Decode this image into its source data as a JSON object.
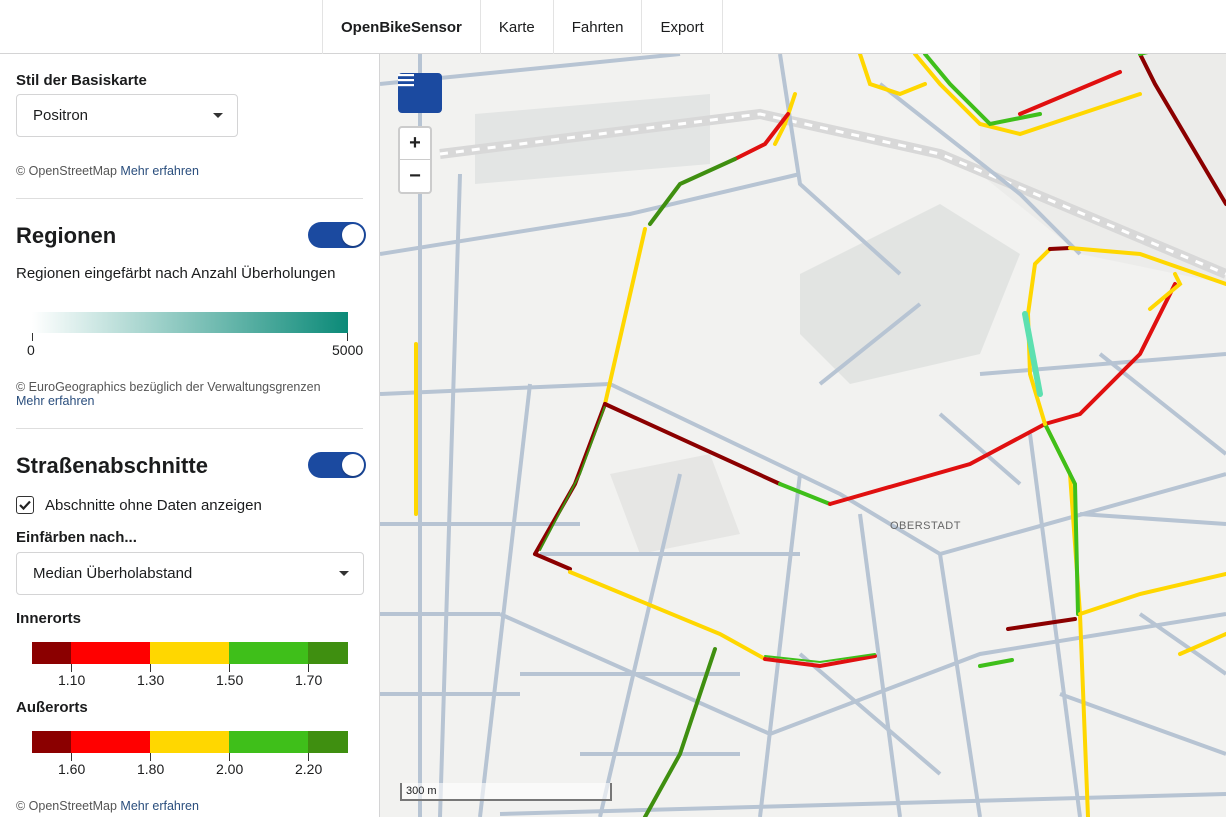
{
  "nav": {
    "brand": "OpenBikeSensor",
    "items": [
      "Karte",
      "Fahrten",
      "Export"
    ]
  },
  "sidebar": {
    "basemap": {
      "label": "Stil der Basiskarte",
      "selected": "Positron",
      "attribution": "© OpenStreetMap",
      "link": "Mehr erfahren"
    },
    "regions": {
      "title": "Regionen",
      "enabled": true,
      "description": "Regionen eingefärbt nach Anzahl Überholungen",
      "gradient_min": "0",
      "gradient_max": "5000",
      "gradient_colors": [
        "#ffffff",
        "#0b8a78"
      ],
      "attribution": "© EuroGeographics bezüglich der Verwaltungsgrenzen",
      "link": "Mehr erfahren"
    },
    "segments": {
      "title": "Straßenabschnitte",
      "enabled": true,
      "checkbox_label": "Abschnitte ohne Daten anzeigen",
      "checkbox_checked": true,
      "color_by_label": "Einfärben nach...",
      "color_by_selected": "Median Überholabstand",
      "innerorts": {
        "title": "Innerorts",
        "ticks": [
          "1.10",
          "1.30",
          "1.50",
          "1.70"
        ]
      },
      "ausserorts": {
        "title": "Außerorts",
        "ticks": [
          "1.60",
          "1.80",
          "2.00",
          "2.20"
        ]
      },
      "scale_colors": [
        "#8b0000",
        "#ff0000",
        "#ffd700",
        "#3fbf1a",
        "#3f8f10"
      ],
      "attribution": "© OpenStreetMap",
      "link": "Mehr erfahren"
    }
  },
  "map": {
    "district_label": "OBERSTADT",
    "scale_label": "300 m",
    "zoom_in": "+",
    "zoom_out": "−",
    "menu_icon": "hamburger-menu-icon"
  }
}
